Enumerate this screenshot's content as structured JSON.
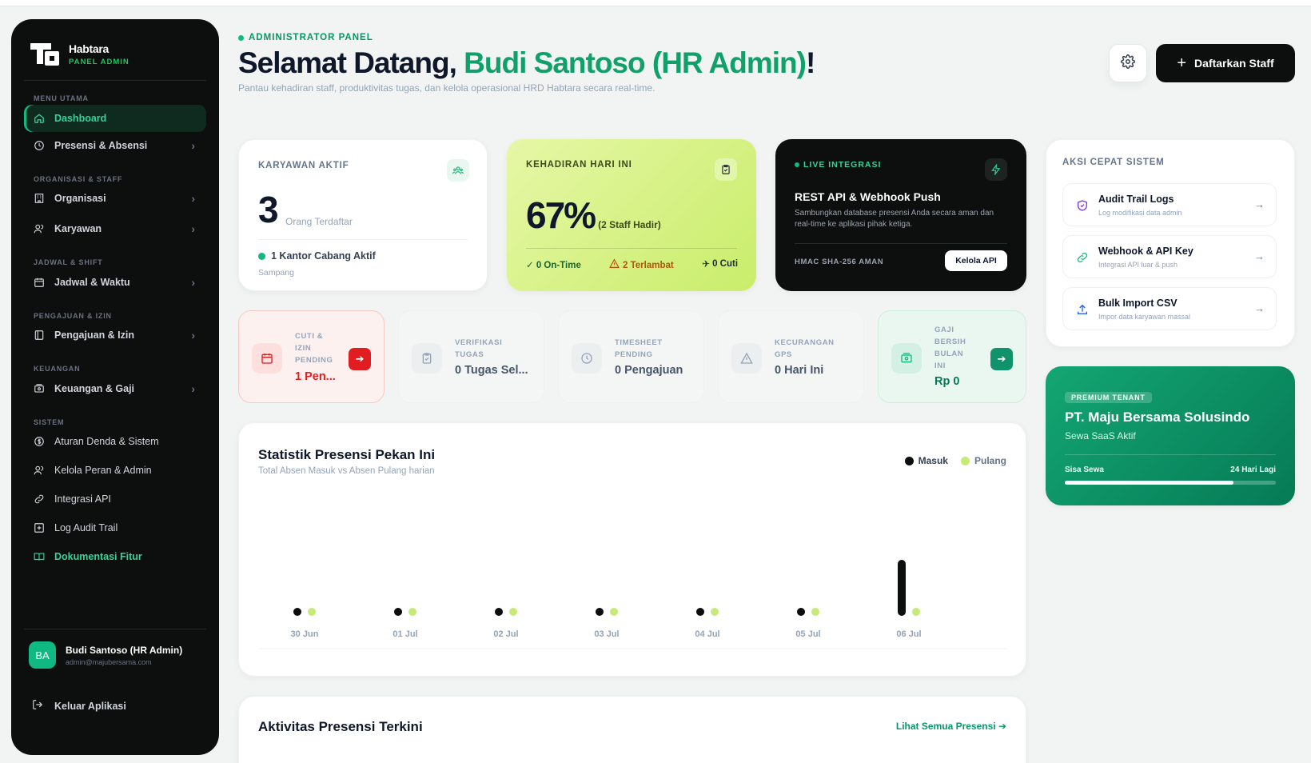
{
  "sidebar": {
    "brand_name": "Habtara",
    "brand_sub": "PANEL ADMIN",
    "sections": {
      "main": "MENU UTAMA",
      "org": "ORGANISASI & STAFF",
      "schedule": "JADWAL & SHIFT",
      "requests": "PENGAJUAN & IZIN",
      "finance": "KEUANGAN",
      "system": "SISTEM"
    },
    "items": {
      "dashboard": "Dashboard",
      "presensi": "Presensi & Absensi",
      "organisasi": "Organisasi",
      "karyawan": "Karyawan",
      "jadwal": "Jadwal & Waktu",
      "pengajuan": "Pengajuan & Izin",
      "keuangan": "Keuangan & Gaji",
      "aturan": "Aturan Denda & Sistem",
      "peran": "Kelola Peran & Admin",
      "integrasi": "Integrasi API",
      "audit": "Log Audit Trail",
      "dokumentasi": "Dokumentasi Fitur"
    },
    "user": {
      "initials": "BA",
      "name": "Budi Santoso (HR Admin)",
      "email": "admin@majubersama.com"
    },
    "logout": "Keluar Aplikasi"
  },
  "header": {
    "eyebrow": "ADMINISTRATOR PANEL",
    "title_prefix": "Selamat Datang, ",
    "title_name": "Budi Santoso (HR Admin)",
    "title_suffix": "!",
    "subtitle": "Pantau kehadiran staff, produktivitas tugas, dan kelola operasional HRD Habtara secara real-time.",
    "primary_button": "Daftarkan Staff"
  },
  "karyawan_card": {
    "label": "KARYAWAN AKTIF",
    "value": "3",
    "unit": "Orang Terdaftar",
    "branch": "1 Kantor Cabang Aktif",
    "city": "Sampang"
  },
  "kehadiran_card": {
    "label": "KEHADIRAN HARI INI",
    "value": "67%",
    "detail": "(2 Staff Hadir)",
    "ontime": "✓ 0 On-Time",
    "late": "2 Terlambat",
    "leave": "0 Cuti"
  },
  "api_card": {
    "label": "LIVE INTEGRASI",
    "title": "REST API & Webhook Push",
    "desc": "Sambungkan database presensi Anda secara aman dan real-time ke aplikasi pihak ketiga.",
    "footer": "HMAC SHA-256 AMAN",
    "button": "Kelola API"
  },
  "tiles": {
    "cuti": {
      "label": "CUTI & IZIN PENDING",
      "value": "1 Pen..."
    },
    "verifikasi": {
      "label": "VERIFIKASI TUGAS",
      "value": "0 Tugas Sel..."
    },
    "timesheet": {
      "label": "TIMESHEET PENDING",
      "value": "0 Pengajuan"
    },
    "gps": {
      "label": "KECURANGAN GPS",
      "value": "0 Hari Ini"
    },
    "gaji": {
      "label": "GAJI BERSIH BULAN INI",
      "value": "Rp 0"
    }
  },
  "quick_actions": {
    "title": "AKSI CEPAT SISTEM",
    "items": [
      {
        "title": "Audit Trail Logs",
        "sub": "Log modifikasi data admin"
      },
      {
        "title": "Webhook & API Key",
        "sub": "Integrasi API luar & push"
      },
      {
        "title": "Bulk Import CSV",
        "sub": "Impor data karyawan massal"
      }
    ]
  },
  "tenant": {
    "badge": "PREMIUM TENANT",
    "name": "PT. Maju Bersama Solusindo",
    "plan": "Sewa SaaS Aktif",
    "remaining_label": "Sisa Sewa",
    "remaining_value": "24 Hari Lagi",
    "progress": 0.8
  },
  "activity": {
    "title": "Aktivitas Presensi Terkini",
    "link": "Lihat Semua Presensi ➔"
  },
  "colors": {
    "brand": "#10b981",
    "masuk": "#0c0f0e",
    "pulang": "#c6ea78",
    "alert": "#e11d22"
  },
  "chart_data": {
    "type": "bar",
    "title": "Statistik Presensi Pekan Ini",
    "subtitle": "Total Absen Masuk vs Absen Pulang harian",
    "categories": [
      "30 Jun",
      "01 Jul",
      "02 Jul",
      "03 Jul",
      "04 Jul",
      "05 Jul",
      "06 Jul"
    ],
    "series": [
      {
        "name": "Masuk",
        "values": [
          0,
          0,
          0,
          0,
          0,
          0,
          2
        ]
      },
      {
        "name": "Pulang",
        "values": [
          0,
          0,
          0,
          0,
          0,
          0,
          0
        ]
      }
    ],
    "legend": "top-right",
    "grid": false
  }
}
